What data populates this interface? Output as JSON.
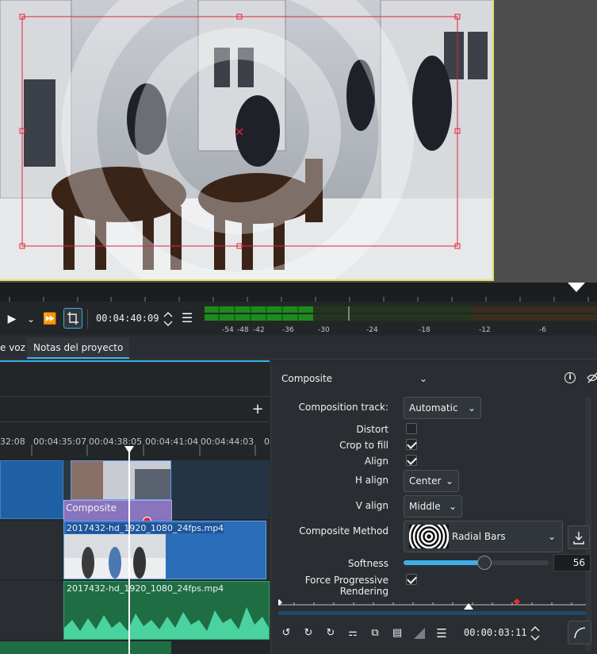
{
  "monitor": {
    "timecode": "00:04:40:09",
    "meter_labels": [
      "-54",
      "-48",
      "-42",
      "-36",
      "-30",
      "-24",
      "-18",
      "-12",
      "-6"
    ]
  },
  "tabs": [
    "e voz",
    "Notas del proyecto"
  ],
  "timeline": {
    "ruler_labels": [
      "32:08",
      "00:04:35:07",
      "00:04:38:05",
      "00:04:41:04",
      "00:04:44:03",
      "0"
    ],
    "composite_label": "Composite",
    "clip1_name": "2017432-hd_1920_1080_24fps.mp4",
    "clip2_name": "2017432-hd_1920_1080_24fps.mp4"
  },
  "panel": {
    "title": "Composite",
    "composition_track_label": "Composition track:",
    "composition_track_value": "Automatic",
    "distort_label": "Distort",
    "crop_label": "Crop to fill",
    "align_label": "Align",
    "halign_label": "H align",
    "halign_value": "Center",
    "valign_label": "V align",
    "valign_value": "Middle",
    "method_label": "Composite Method",
    "method_value": "Radial Bars",
    "softness_label": "Softness",
    "softness_value": "56",
    "softness_fraction": 0.56,
    "progressive_label": "Force Progressive Rendering",
    "keyframe_timecode": "00:00:03:11"
  },
  "colors": {
    "accent": "#3daee9",
    "clip_video": "#2a6db8",
    "clip_audio": "#227a47",
    "composite": "#9a7fd4",
    "marker": "#e83030"
  }
}
